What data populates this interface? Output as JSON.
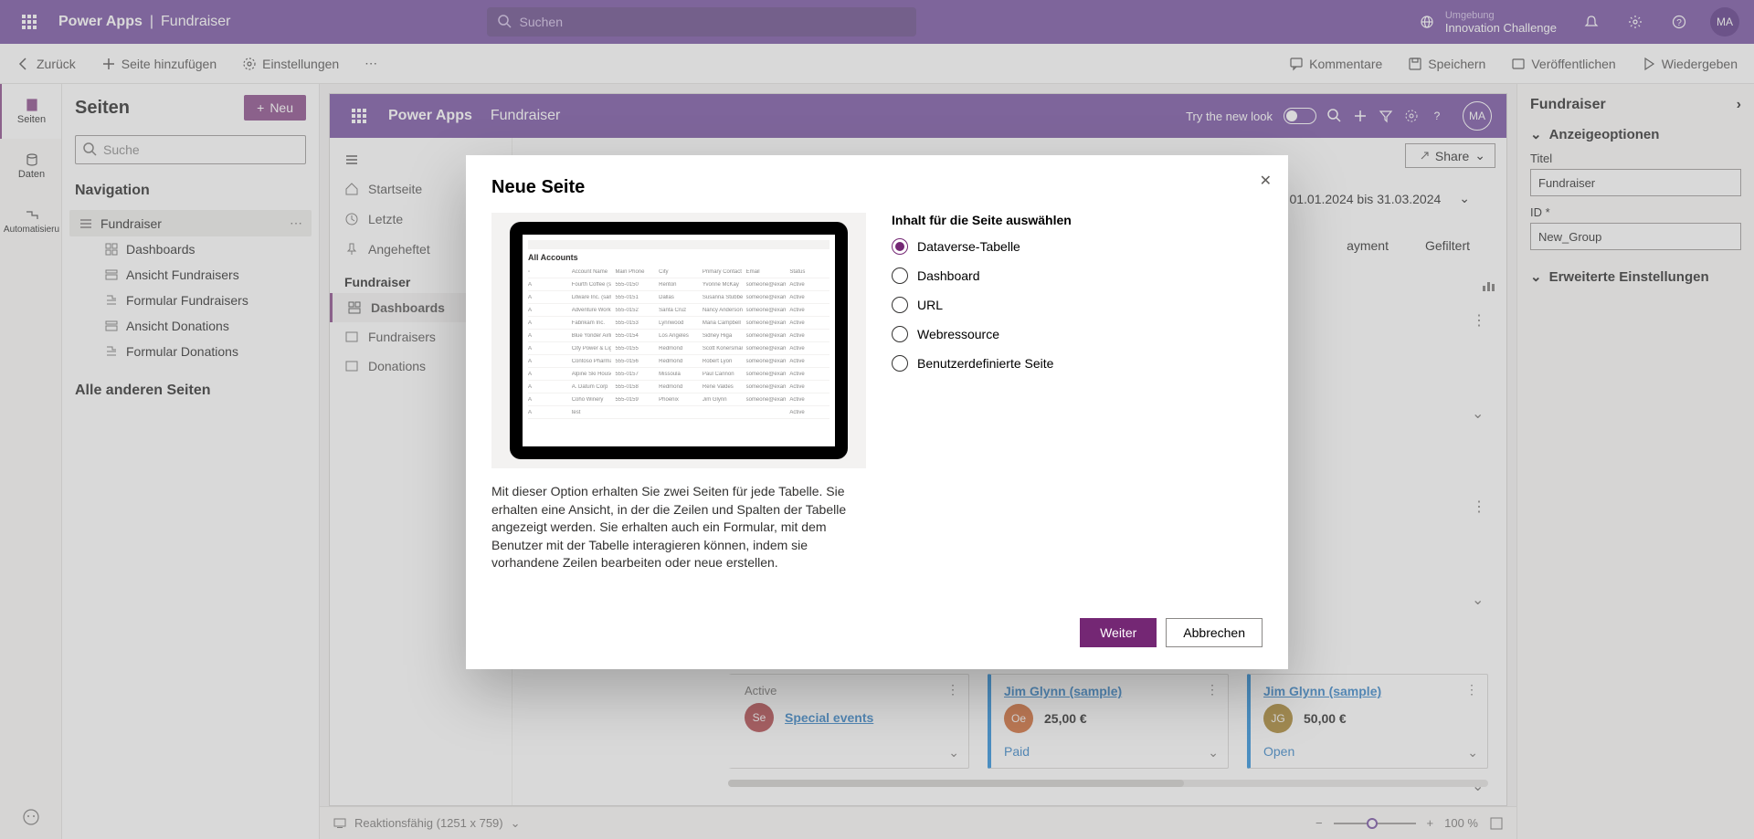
{
  "topbar": {
    "app": "Power Apps",
    "sub": "Fundraiser",
    "search_placeholder": "Suchen",
    "env_label": "Umgebung",
    "env_name": "Innovation Challenge",
    "avatar": "MA"
  },
  "cmdbar": {
    "back": "Zurück",
    "add_page": "Seite hinzufügen",
    "settings": "Einstellungen",
    "comments": "Kommentare",
    "save": "Speichern",
    "publish": "Veröffentlichen",
    "play": "Wiedergeben"
  },
  "rail": {
    "pages": "Seiten",
    "data": "Daten",
    "automate": "Automatisieru"
  },
  "pages": {
    "title": "Seiten",
    "new": "Neu",
    "search_placeholder": "Suche",
    "nav": "Navigation",
    "all_other": "Alle anderen Seiten",
    "items": [
      "Fundraiser",
      "Dashboards",
      "Ansicht Fundraisers",
      "Formular Fundraisers",
      "Ansicht Donations",
      "Formular Donations"
    ]
  },
  "canvas": {
    "app": "Power Apps",
    "sub": "Fundraiser",
    "try_new": "Try the new look",
    "avatar": "MA",
    "side": {
      "home": "Startseite",
      "recent": "Letzte",
      "pinned": "Angeheftet",
      "section": "Fundraiser",
      "dashboards": "Dashboards",
      "fundraisers": "Fundraisers",
      "donations": "Donations"
    },
    "share": "Share",
    "date_range": "01.01.2024 bis 31.03.2024",
    "tab_payment": "ayment",
    "tab_filtered": "Gefiltert",
    "cards": [
      {
        "status": "Active",
        "link": "Special events",
        "pill": "Se",
        "pill_color": "#a4262c"
      },
      {
        "link": "Jim Glynn (sample)",
        "amount": "25,00 €",
        "pill": "Oe",
        "pill_color": "#ca5010",
        "foot": "Paid"
      },
      {
        "link": "Jim Glynn (sample)",
        "amount": "50,00 €",
        "pill": "JG",
        "pill_color": "#986f0b",
        "foot": "Open"
      }
    ],
    "footer": {
      "responsive": "Reaktionsfähig (1251 x 759)",
      "zoom": "100 %"
    }
  },
  "right": {
    "title": "Fundraiser",
    "group_display": "Anzeigeoptionen",
    "title_label": "Titel",
    "title_value": "Fundraiser",
    "id_label": "ID *",
    "id_value": "New_Group",
    "group_adv": "Erweiterte Einstellungen"
  },
  "modal": {
    "title": "Neue Seite",
    "radio_title": "Inhalt für die Seite auswählen",
    "options": [
      "Dataverse-Tabelle",
      "Dashboard",
      "URL",
      "Webressource",
      "Benutzerdefinierte Seite"
    ],
    "desc": "Mit dieser Option erhalten Sie zwei Seiten für jede Tabelle. Sie erhalten eine Ansicht, in der die Zeilen und Spalten der Tabelle angezeigt werden. Sie erhalten auch ein Formular, mit dem Benutzer mit der Tabelle interagieren können, indem sie vorhandene Zeilen bearbeiten oder neue erstellen.",
    "next": "Weiter",
    "cancel": "Abbrechen",
    "preview_title": "All Accounts"
  }
}
